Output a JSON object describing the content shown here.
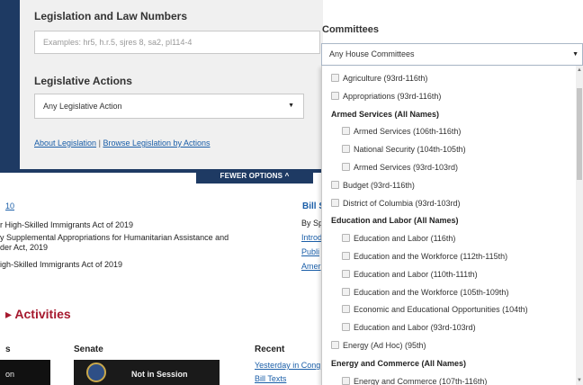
{
  "search_panel": {
    "legislation_heading": "Legislation and Law Numbers",
    "legislation_placeholder": "Examples: hr5, h.r.5, sjres 8, sa2, pl114-4",
    "actions_heading": "Legislative Actions",
    "actions_selected": "Any Legislative Action",
    "about_link": "About Legislation",
    "separator": "|",
    "browse_link": "Browse Legislation by Actions",
    "fewer_options": "FEWER OPTIONS ^"
  },
  "background": {
    "link_fragment": "10",
    "items": [
      "r High-Skilled Immigrants Act of 2019",
      "y Supplemental Appropriations for Humanitarian Assistance and",
      "der Act, 2019",
      "igh-Skilled Immigrants Act of 2019"
    ],
    "bill_heading": "Bill S",
    "bill_lines": [
      "By Sp",
      "Introd",
      "Publi",
      "Amer"
    ],
    "activities_title": "Activities",
    "columns": {
      "left": "s",
      "senate": "Senate",
      "recent": "Recent"
    },
    "thumb_left_text": "on",
    "senate_status": "Not in Session",
    "recent_links": [
      "Yesterday in Cong",
      "Bill Texts"
    ]
  },
  "committees": {
    "label": "Committees",
    "selected": "Any House Committees",
    "options": [
      {
        "label": "Agriculture (93rd-116th)",
        "group": false,
        "indent": false
      },
      {
        "label": "Appropriations (93rd-116th)",
        "group": false,
        "indent": false
      },
      {
        "label": "Armed Services (All Names)",
        "group": true,
        "indent": false
      },
      {
        "label": "Armed Services (106th-116th)",
        "group": false,
        "indent": true
      },
      {
        "label": "National Security (104th-105th)",
        "group": false,
        "indent": true
      },
      {
        "label": "Armed Services (93rd-103rd)",
        "group": false,
        "indent": true
      },
      {
        "label": "Budget (93rd-116th)",
        "group": false,
        "indent": false
      },
      {
        "label": "District of Columbia (93rd-103rd)",
        "group": false,
        "indent": false
      },
      {
        "label": "Education and Labor (All Names)",
        "group": true,
        "indent": false
      },
      {
        "label": "Education and Labor (116th)",
        "group": false,
        "indent": true
      },
      {
        "label": "Education and the Workforce (112th-115th)",
        "group": false,
        "indent": true
      },
      {
        "label": "Education and Labor (110th-111th)",
        "group": false,
        "indent": true
      },
      {
        "label": "Education and the Workforce (105th-109th)",
        "group": false,
        "indent": true
      },
      {
        "label": "Economic and Educational Opportunities (104th)",
        "group": false,
        "indent": true
      },
      {
        "label": "Education and Labor (93rd-103rd)",
        "group": false,
        "indent": true
      },
      {
        "label": "Energy (Ad Hoc) (95th)",
        "group": false,
        "indent": false
      },
      {
        "label": "Energy and Commerce (All Names)",
        "group": true,
        "indent": false
      },
      {
        "label": "Energy and Commerce (107th-116th)",
        "group": false,
        "indent": true
      }
    ]
  }
}
